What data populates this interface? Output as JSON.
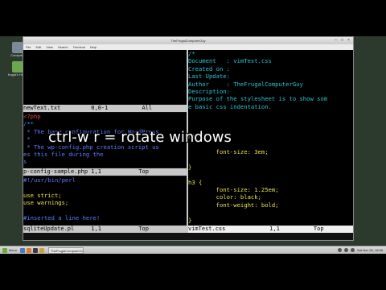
{
  "desktop": {
    "icons": [
      {
        "name": "computer-icon",
        "label": "Computer"
      },
      {
        "name": "home-folder-icon",
        "label": "frugal's Home"
      }
    ]
  },
  "window": {
    "title": "TheFrugalComputerGuy",
    "menu": [
      "File",
      "Edit",
      "View",
      "Search",
      "Terminal",
      "Help"
    ]
  },
  "panes": {
    "top_left": {
      "status": "newText.txt         0,0-1          All"
    },
    "mid_left": {
      "lines": [
        {
          "text": "<?php",
          "color": "red"
        },
        {
          "text": "/**",
          "color": "blue"
        },
        {
          "text": " * The base configuration for WordPress",
          "color": "blue"
        },
        {
          "text": " *",
          "color": "blue"
        },
        {
          "text": " * The wp-config.php creation script us",
          "color": "blue"
        },
        {
          "text": "es this file during the",
          "color": "blue"
        },
        {
          "text": "s",
          "color": "blue"
        }
      ],
      "status": "p-config-sample.php 1,1           Top"
    },
    "bottom_left": {
      "lines": [
        {
          "text": "#!/usr/bin/perl",
          "color": "blue"
        },
        {
          "text": "",
          "color": "grey"
        },
        {
          "text": "use strict;",
          "color": "yellow"
        },
        {
          "text": "use warnings;",
          "color": "yellow"
        },
        {
          "text": "",
          "color": "grey"
        },
        {
          "text": "#inserted a line here!",
          "color": "blue"
        }
      ],
      "status": "sqliteUpdate.pl     1,1           Top"
    },
    "right": {
      "lines": [
        {
          "text": "/*",
          "color": "cyan"
        },
        {
          "text": "Document   : vimTest.css",
          "color": "cyan"
        },
        {
          "text": "Created on :",
          "color": "cyan"
        },
        {
          "text": "Last Update:",
          "color": "cyan"
        },
        {
          "text": "Author     : TheFrugalComputerGuy",
          "color": "cyan"
        },
        {
          "text": "Description:",
          "color": "cyan"
        },
        {
          "text": "Purpose of the stylesheet is to show som",
          "color": "cyan"
        },
        {
          "text": "e basic css indentation.",
          "color": "cyan"
        },
        {
          "text": "",
          "color": "grey"
        },
        {
          "text": "",
          "color": "grey"
        },
        {
          "text": "",
          "color": "grey"
        },
        {
          "text": "h1 {",
          "color": "yellow"
        },
        {
          "text": "",
          "color": "grey"
        },
        {
          "text": "        font-size: 3em;",
          "color": "yellow"
        },
        {
          "text": "",
          "color": "grey"
        },
        {
          "text": "}",
          "color": "yellow"
        },
        {
          "text": "",
          "color": "grey"
        },
        {
          "text": "h3 {",
          "color": "yellow"
        },
        {
          "text": "        font-size: 1.25em;",
          "color": "yellow"
        },
        {
          "text": "        color: black;",
          "color": "yellow"
        },
        {
          "text": "        font-weight: bold;",
          "color": "yellow"
        },
        {
          "text": "",
          "color": "grey"
        },
        {
          "text": "}",
          "color": "yellow"
        }
      ],
      "status": "vimTest.css             1,1          Top"
    }
  },
  "overlay_caption": "ctrl-w r = rotate windows",
  "taskbar": {
    "menu_label": "Menu",
    "task_label": "TheFrugalComputerGuy",
    "clock": "Sat Nov 28, 16:58"
  }
}
